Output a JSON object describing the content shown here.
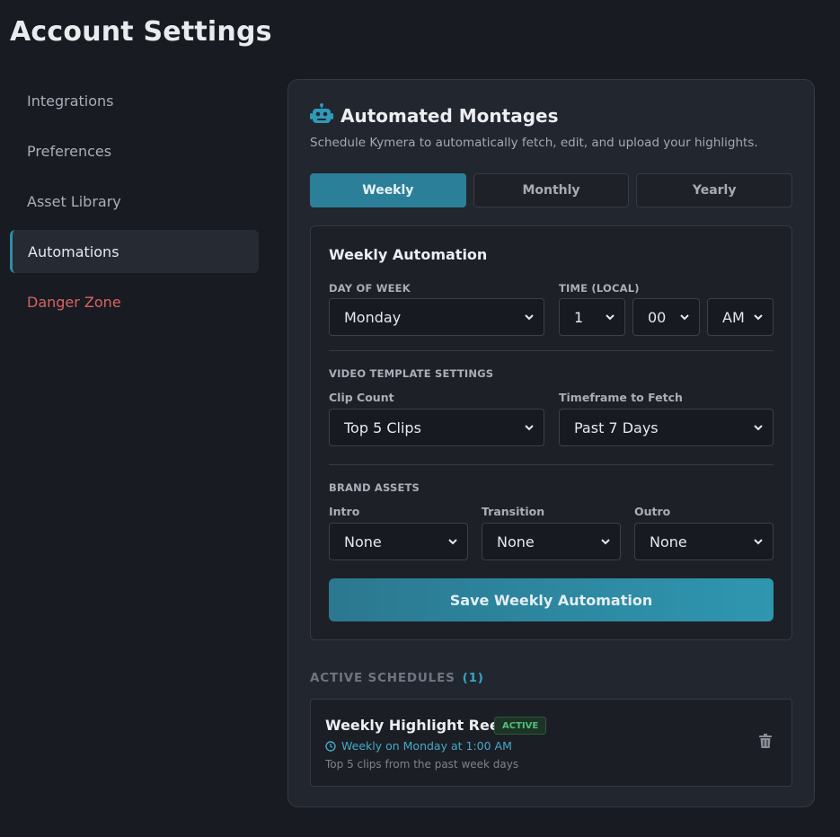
{
  "page": {
    "title": "Account Settings"
  },
  "sidebar": {
    "items": [
      {
        "label": "Integrations"
      },
      {
        "label": "Preferences"
      },
      {
        "label": "Asset Library"
      },
      {
        "label": "Automations",
        "active": true
      },
      {
        "label": "Danger Zone",
        "danger": true
      }
    ]
  },
  "card": {
    "icon": "robot-icon",
    "title": "Automated Montages",
    "description": "Schedule Kymera to automatically fetch, edit, and upload your highlights."
  },
  "tabs": [
    {
      "label": "Weekly",
      "active": true
    },
    {
      "label": "Monthly"
    },
    {
      "label": "Yearly"
    }
  ],
  "form": {
    "title": "Weekly Automation",
    "day_label": "DAY OF WEEK",
    "day_value": "Monday",
    "time_label": "TIME (LOCAL)",
    "hour_value": "1",
    "minute_value": "00",
    "ampm_value": "AM",
    "template_section": "VIDEO TEMPLATE SETTINGS",
    "clip_count_label": "Clip Count",
    "clip_count_value": "Top 5 Clips",
    "timeframe_label": "Timeframe to Fetch",
    "timeframe_value": "Past 7 Days",
    "brand_section": "BRAND ASSETS",
    "intro_label": "Intro",
    "intro_value": "None",
    "transition_label": "Transition",
    "transition_value": "None",
    "outro_label": "Outro",
    "outro_value": "None",
    "save_label": "Save Weekly Automation"
  },
  "schedules": {
    "header": "ACTIVE SCHEDULES",
    "count": "(1)",
    "items": [
      {
        "title": "Weekly Highlight Reel",
        "status": "ACTIVE",
        "when": "Weekly on Monday at 1:00 AM",
        "description": "Top 5 clips from the past week days"
      }
    ]
  },
  "colors": {
    "background": "#181b22",
    "accent": "#2c7f98",
    "danger": "#d9625f",
    "active_badge": "#4fc27a"
  }
}
